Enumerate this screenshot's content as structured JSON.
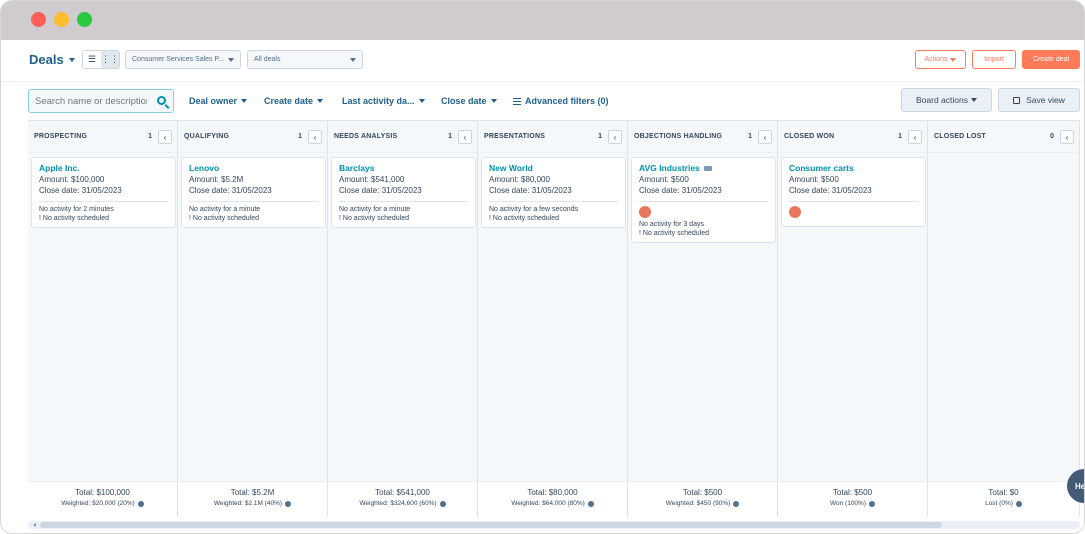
{
  "header": {
    "title": "Deals",
    "pipeline_select": "Consumer Services Sales P...",
    "view_select": "All deals",
    "actions_label": "Actions",
    "import_label": "Import",
    "create_label": "Create deal"
  },
  "filters": {
    "search_placeholder": "Search name or description",
    "deal_owner": "Deal owner",
    "create_date": "Create date",
    "last_activity": "Last activity da...",
    "close_date": "Close date",
    "advanced": "Advanced filters (0)",
    "board_actions": "Board actions",
    "save_view": "Save view"
  },
  "columns": [
    {
      "name": "PROSPECTING",
      "count": "1",
      "card": {
        "title": "Apple Inc.",
        "amount": "Amount: $100,000",
        "close": "Close date: 31/05/2023",
        "activity": "No activity for 2 minutes",
        "scheduled": "! No activity scheduled"
      },
      "total": "Total: $100,000",
      "weighted": "Weighted: $20,000 (20%)"
    },
    {
      "name": "QUALIFYING",
      "count": "1",
      "card": {
        "title": "Lenovo",
        "amount": "Amount: $5.2M",
        "close": "Close date: 31/05/2023",
        "activity": "No activity for a minute",
        "scheduled": "! No activity scheduled"
      },
      "total": "Total: $5.2M",
      "weighted": "Weighted: $2.1M (40%)"
    },
    {
      "name": "NEEDS ANALYSIS",
      "count": "1",
      "card": {
        "title": "Barclays",
        "amount": "Amount: $541,000",
        "close": "Close date: 31/05/2023",
        "activity": "No activity for a minute",
        "scheduled": "! No activity scheduled"
      },
      "total": "Total: $541,000",
      "weighted": "Weighted: $324,600 (60%)"
    },
    {
      "name": "PRESENTATIONS",
      "count": "1",
      "card": {
        "title": "New World",
        "amount": "Amount: $80,000",
        "close": "Close date: 31/05/2023",
        "activity": "No activity for a few seconds",
        "scheduled": "! No activity scheduled"
      },
      "total": "Total: $80,000",
      "weighted": "Weighted: $64,000 (80%)"
    },
    {
      "name": "OBJECTIONS HANDLING",
      "count": "1",
      "card": {
        "title": "AVG Industries",
        "amount": "Amount: $500",
        "close": "Close date: 31/05/2023",
        "activity": "No activity for 3 days",
        "scheduled": "! No activity scheduled"
      },
      "total": "Total: $500",
      "weighted": "Weighted: $450 (90%)"
    },
    {
      "name": "CLOSED WON",
      "count": "1",
      "card": {
        "title": "Consumer carts",
        "amount": "Amount: $500",
        "close": "Close date: 31/05/2023"
      },
      "total": "Total: $500",
      "weighted": "Won (100%)"
    },
    {
      "name": "CLOSED LOST",
      "count": "0",
      "total": "Total: $0",
      "weighted": "Lost (0%)"
    }
  ],
  "help_label": "He",
  "colors": {
    "accent": "#ff7a59",
    "link": "#0091ae",
    "title": "#1f5f8b",
    "avatar": "#e8765a"
  }
}
